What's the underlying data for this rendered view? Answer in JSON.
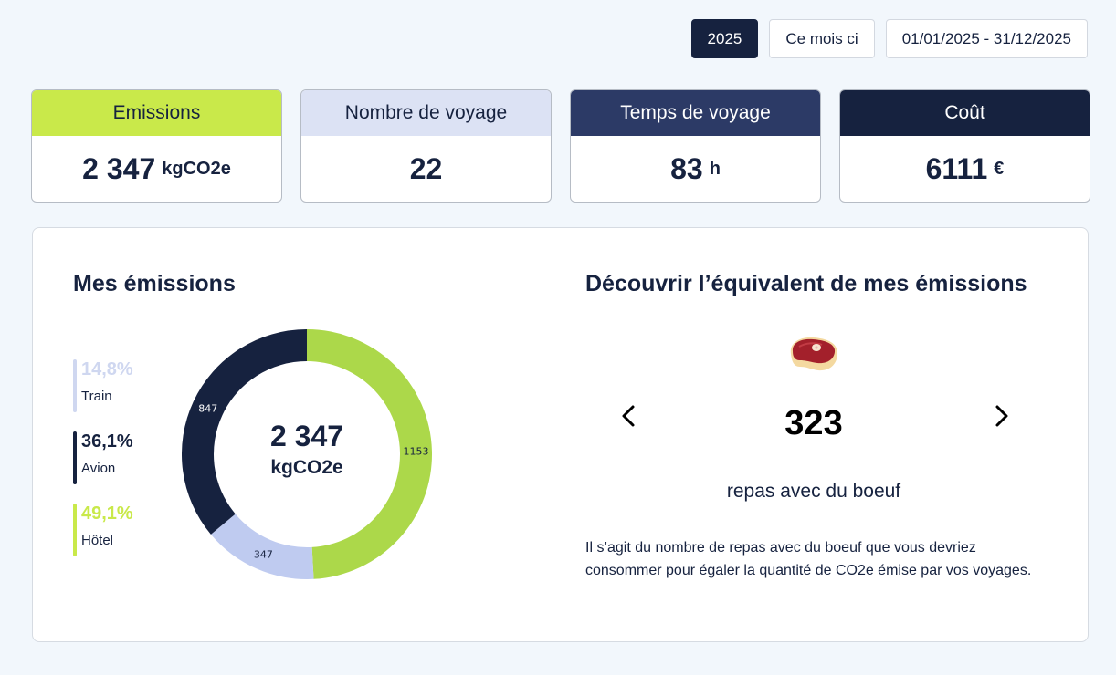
{
  "filters": [
    {
      "label": "2025",
      "active": true
    },
    {
      "label": "Ce mois ci",
      "active": false
    },
    {
      "label": "01/01/2025 - 31/12/2025",
      "active": false
    }
  ],
  "kpis": {
    "emissions": {
      "title": "Emissions",
      "value": "2 347",
      "unit": "kgCO2e"
    },
    "trips": {
      "title": "Nombre de voyage",
      "value": "22",
      "unit": ""
    },
    "time": {
      "title": "Temps de voyage",
      "value": "83",
      "unit": "h"
    },
    "cost": {
      "title": "Coût",
      "value": "6111",
      "unit": "€"
    }
  },
  "emissions_section": {
    "title": "Mes émissions",
    "legend": [
      {
        "pct": "14,8%",
        "label": "Train",
        "color": "#cfd7f0"
      },
      {
        "pct": "36,1%",
        "label": "Avion",
        "color": "#16223f"
      },
      {
        "pct": "49,1%",
        "label": "Hôtel",
        "color": "#c9e94a"
      }
    ],
    "total_value": "2 347",
    "total_unit": "kgCO2e"
  },
  "chart_data": {
    "type": "pie",
    "categories": [
      "Hôtel",
      "Train",
      "Avion"
    ],
    "values": [
      1153,
      347,
      847
    ],
    "colors": [
      "#acd84a",
      "#bfcbf0",
      "#16223f"
    ],
    "data_labels": [
      "1153",
      "347",
      "847"
    ]
  },
  "equivalence": {
    "title": "Découvrir l’équivalent de mes émissions",
    "icon": "steak-icon",
    "value": "323",
    "label": "repas avec du boeuf",
    "description": "Il s’agit du nombre de repas avec du boeuf que vous devriez consommer pour égaler la quantité de CO2e émise par vos voyages."
  }
}
